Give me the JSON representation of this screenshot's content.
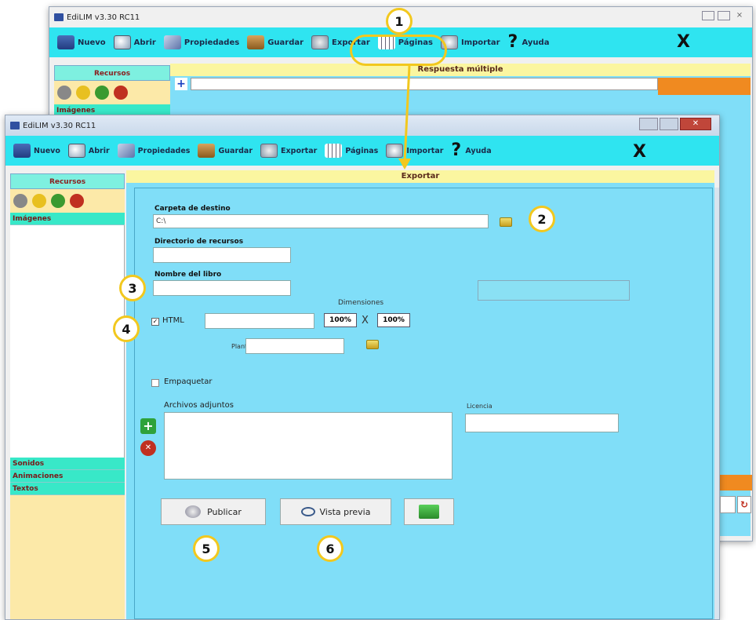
{
  "back_window": {
    "title": "EdiLIM  v3.30 RC11",
    "toolbar": [
      "Nuevo",
      "Abrir",
      "Propiedades",
      "Guardar",
      "Exportar",
      "Páginas",
      "Importar",
      "Ayuda"
    ],
    "sidebar_header": "Recursos",
    "sidebar_cat": "Imágenes",
    "section_title": "Respuesta múltiple"
  },
  "front_window": {
    "title": "EdiLIM  v3.30 RC11",
    "toolbar": {
      "nuevo": "Nuevo",
      "abrir": "Abrir",
      "propiedades": "Propiedades",
      "guardar": "Guardar",
      "exportar": "Exportar",
      "paginas": "Páginas",
      "importar": "Importar",
      "ayuda": "Ayuda",
      "close": "X"
    },
    "sidebar": {
      "header": "Recursos",
      "categories": [
        "Imágenes",
        "Sonidos",
        "Animaciones",
        "Textos"
      ]
    },
    "section_title": "Exportar",
    "form": {
      "carpeta_label": "Carpeta de destino",
      "carpeta_value": "C:\\",
      "directorio_label": "Directorio de recursos",
      "nombre_label": "Nombre del libro",
      "dimensiones_label": "Dimensiones",
      "html_label": "HTML",
      "html_checked": true,
      "width_value": "100%",
      "times": "X",
      "height_value": "100%",
      "plantilla_label": "Plantilla",
      "empaquetar_label": "Empaquetar",
      "adjuntos_label": "Archivos adjuntos",
      "licencia_label": "Licencia",
      "publicar_label": "Publicar",
      "vista_previa_label": "Vista previa"
    }
  },
  "callouts": [
    "1",
    "2",
    "3",
    "4",
    "5",
    "6"
  ],
  "colors": {
    "toolbar": "#2fe4f0",
    "content": "#80def8",
    "sidebar": "#fce9a8",
    "highlight": "#f2c81e"
  }
}
